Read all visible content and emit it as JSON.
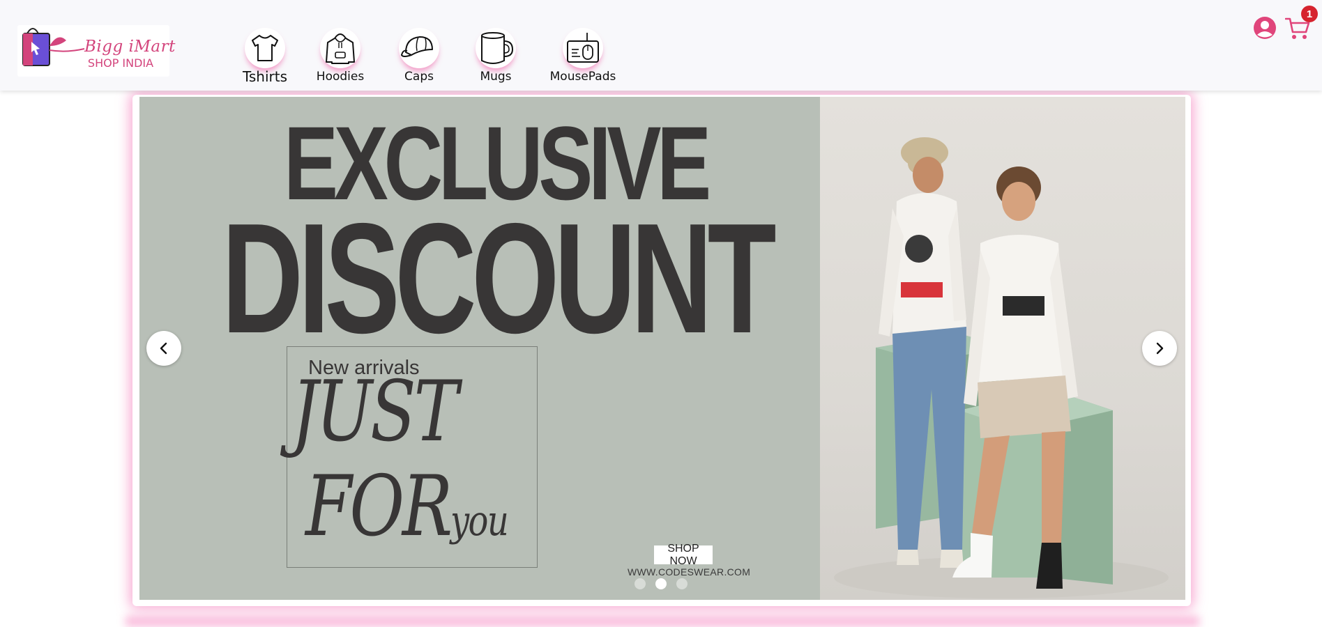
{
  "brand": {
    "name": "Bigg iMart",
    "tagline": "SHOP INDIA",
    "accent_color": "#d3447c"
  },
  "nav": {
    "categories": [
      {
        "label": "Tshirts",
        "icon": "tshirt-icon"
      },
      {
        "label": "Hoodies",
        "icon": "hoodie-icon"
      },
      {
        "label": "Caps",
        "icon": "cap-icon"
      },
      {
        "label": "Mugs",
        "icon": "mug-icon"
      },
      {
        "label": "MousePads",
        "icon": "mousepad-icon"
      }
    ]
  },
  "header_actions": {
    "account_icon": "user-circle-icon",
    "cart_icon": "shopping-cart-icon",
    "cart_count": "1",
    "icon_color": "#e0457b",
    "badge_color": "#d6232e"
  },
  "banner": {
    "headline_line1": "EXCLUSIVE",
    "headline_line2": "DISCOUNT",
    "subheading": "New arrivals",
    "script_line1": "JUST",
    "script_line2": "FOR",
    "script_line2_small": "you",
    "cta_label": "SHOP NOW",
    "website": "WWW.CODESWEAR.COM",
    "background_color": "#b8bfb7",
    "text_color": "#383636"
  },
  "carousel": {
    "slide_count": 3,
    "active_slide": 2,
    "prev_icon": "chevron-left-icon",
    "next_icon": "chevron-right-icon"
  }
}
